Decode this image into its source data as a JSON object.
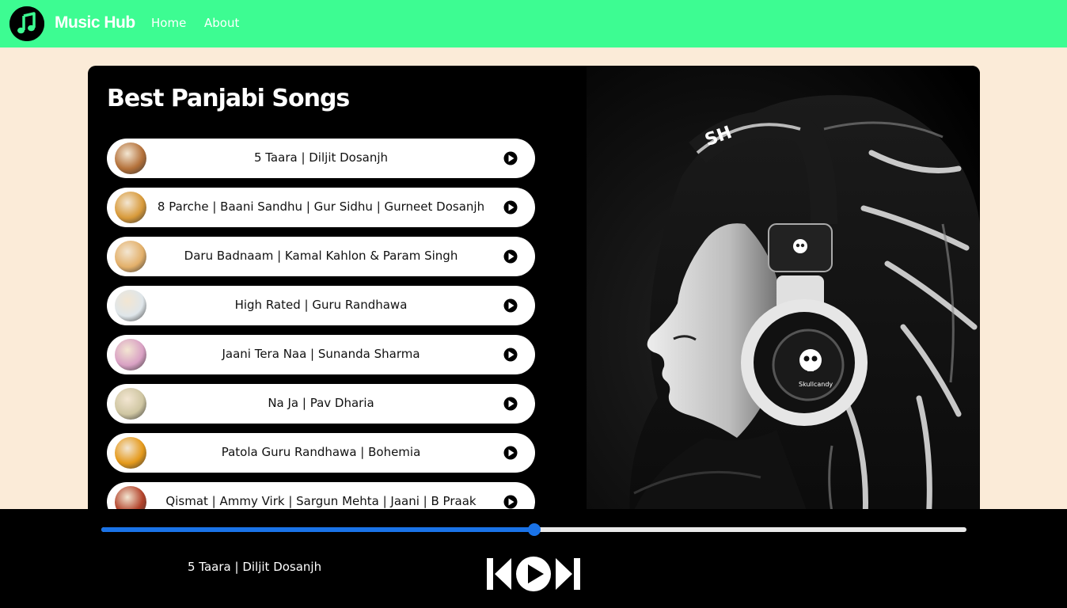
{
  "nav": {
    "brand": "Music Hub",
    "links": [
      "Home",
      "About"
    ]
  },
  "playlist": {
    "title": "Best Panjabi Songs",
    "songs": [
      {
        "name": "5 Taara | Diljit Dosanjh",
        "cover": "#b4713a"
      },
      {
        "name": "8 Parche | Baani Sandhu | Gur Sidhu | Gurneet Dosanjh",
        "cover": "#d89a3a"
      },
      {
        "name": "Daru Badnaam | Kamal Kahlon & Param Singh",
        "cover": "#e3b06a"
      },
      {
        "name": "High Rated | Guru Randhawa",
        "cover": "#dfe6ea"
      },
      {
        "name": "Jaani Tera Naa | Sunanda Sharma",
        "cover": "#d9a1c4"
      },
      {
        "name": "Na Ja | Pav Dharia",
        "cover": "#cfc6a2"
      },
      {
        "name": "Patola Guru Randhawa | Bohemia",
        "cover": "#e59a1c"
      },
      {
        "name": "Qismat | Ammy Virk | Sargun Mehta | Jaani | B Praak",
        "cover": "#b3432b"
      }
    ]
  },
  "player": {
    "now_playing": "5 Taara | Diljit Dosanjh",
    "progress": 0.5
  },
  "colors": {
    "navbar": "#3dfc92",
    "background": "#fbebd8",
    "accent": "#1a73e8"
  },
  "icons": {
    "logo": "music-note-icon",
    "song_play": "play-circle-icon",
    "previous": "previous-icon",
    "play": "play-circle-icon",
    "next": "next-icon"
  }
}
